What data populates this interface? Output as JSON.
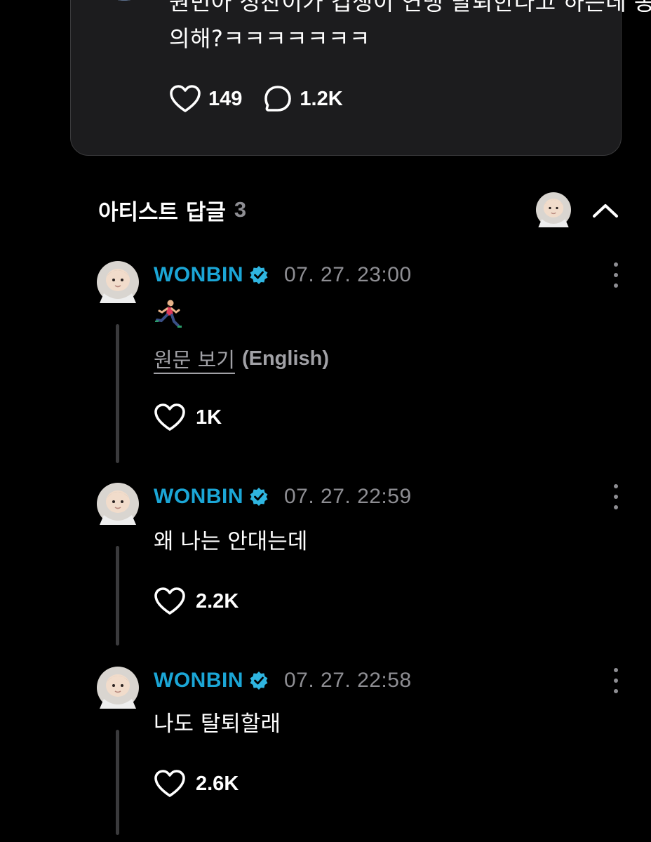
{
  "post": {
    "text": "원빈아 성찬이가 겁쟁이 연맹 탈퇴한다고 하는데 동의해?ㅋㅋㅋㅋㅋㅋㅋ",
    "likes": "149",
    "comments": "1.2K"
  },
  "artist_replies": {
    "title": "아티스트 답글",
    "count": "3"
  },
  "replies": [
    {
      "author": "WONBIN",
      "timestamp": "07. 27. 23:00",
      "content": "🏃‍♀️",
      "translate_label": "원문 보기",
      "translate_lang": "(English)",
      "likes": "1K"
    },
    {
      "author": "WONBIN",
      "timestamp": "07. 27. 22:59",
      "content": "왜 나는 안대는데",
      "likes": "2.2K"
    },
    {
      "author": "WONBIN",
      "timestamp": "07. 27. 22:58",
      "content": "나도 탈퇴할래",
      "likes": "2.6K"
    }
  ],
  "colors": {
    "background": "#000000",
    "card": "#1c1c1e",
    "artist_name": "#1ba6d6",
    "verified_badge": "#2fb5e0",
    "muted_text": "#8e8e93"
  },
  "icons": [
    "heart-icon",
    "comment-bubble-icon",
    "verified-badge-icon",
    "chevron-up-icon",
    "more-vertical-icon",
    "runner-emoji-icon"
  ]
}
